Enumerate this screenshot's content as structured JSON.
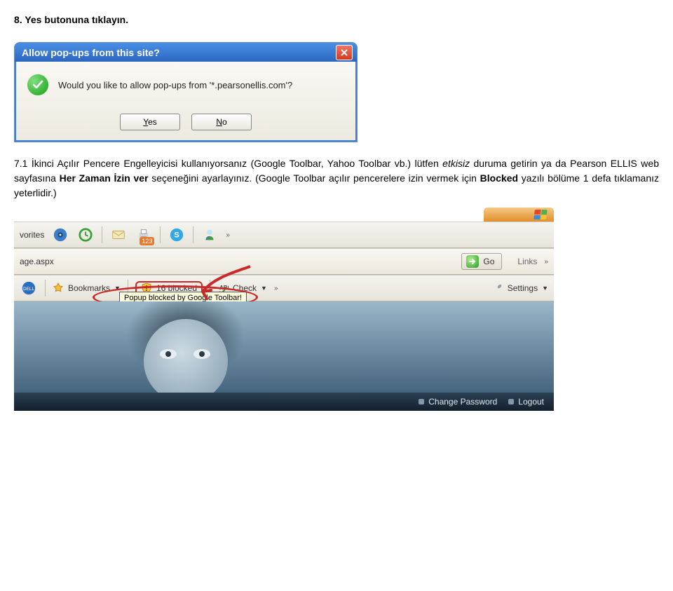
{
  "heading": "8. Yes butonuna tıklayın.",
  "paragraph": {
    "p1": "7.1 İkinci Açılır Pencere Engelleyicisi kullanıyorsanız (Google Toolbar, Yahoo Toolbar vb.) lütfen ",
    "p2_italic": "etkisiz",
    "p3": " duruma getirin ya da Pearson ELLIS web sayfasına ",
    "p4_bold": "Her Zaman İzin ver",
    "p5": " seçeneğini ayarlayınız. (Google Toolbar açılır pencerelere izin vermek için ",
    "p6_bold": "Blocked",
    "p7": " yazılı bölüme 1 defa tıklamanız yeterlidir.)"
  },
  "dialog": {
    "title": "Allow pop-ups from this site?",
    "question": "Would you like to allow pop-ups from '*.pearsonellis.com'?",
    "yes_label": "Yes",
    "no_label": "No"
  },
  "toolbar": {
    "favorites_label": "vorites",
    "printer_badge": "123",
    "links_label": "Links",
    "go_label": "Go",
    "address_fragment": "age.aspx",
    "bookmarks_label": "Bookmarks",
    "blocked_count": "16 blocked",
    "check_label": "Check",
    "settings_label": "Settings",
    "tooltip": "Popup blocked by Google Toolbar!"
  },
  "footer": {
    "change_password": "Change Password",
    "logout": "Logout"
  },
  "icons": {
    "close": "close-icon",
    "checkmark": "checkmark-icon"
  }
}
